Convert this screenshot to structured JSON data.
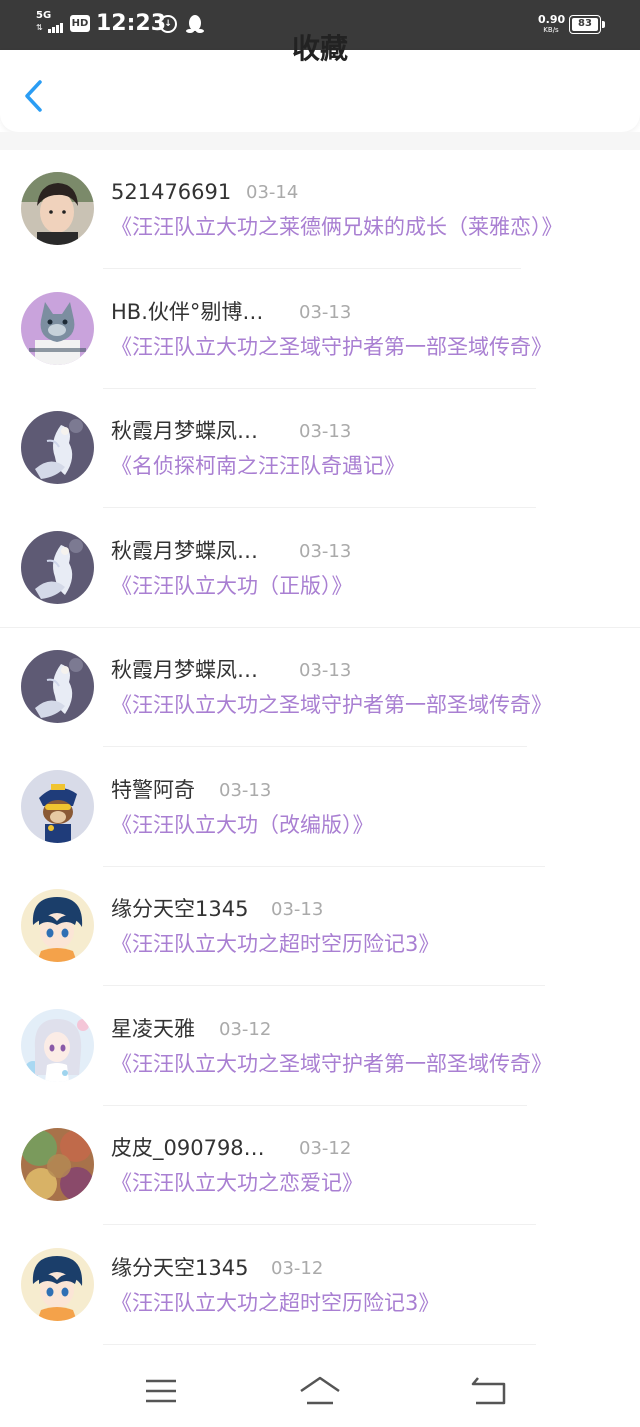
{
  "status_bar": {
    "network": "5G",
    "hd": "HD",
    "time": "12:23",
    "speed_value": "0.90",
    "speed_unit": "KB/s",
    "battery": "83"
  },
  "header": {
    "title": "收藏"
  },
  "items": [
    {
      "name": "521476691",
      "date": "03-14",
      "story": "《汪汪队立大功之莱德俩兄妹的成长（莱雅恋）》",
      "avatar": "boy-photo"
    },
    {
      "name": "HB.伙伴°剔博…",
      "date": "03-13",
      "story": "《汪汪队立大功之圣域守护者第一部圣域传奇》",
      "avatar": "wolf-cartoon"
    },
    {
      "name": "秋霞月梦蝶凤…",
      "date": "03-13",
      "story": "《名侦探柯南之汪汪队奇遇记》",
      "avatar": "white-anime-girl"
    },
    {
      "name": "秋霞月梦蝶凤…",
      "date": "03-13",
      "story": "《汪汪队立大功（正版）》",
      "avatar": "white-anime-girl"
    },
    {
      "name": "秋霞月梦蝶凤…",
      "date": "03-13",
      "story": "《汪汪队立大功之圣域守护者第一部圣域传奇》",
      "avatar": "white-anime-girl"
    },
    {
      "name": "特警阿奇",
      "date": "03-13",
      "story": "《汪汪队立大功（改编版）》",
      "avatar": "police-dog"
    },
    {
      "name": "缘分天空1345",
      "date": "03-13",
      "story": "《汪汪队立大功之超时空历险记3》",
      "avatar": "anime-boy"
    },
    {
      "name": "星凌天雅",
      "date": "03-12",
      "story": "《汪汪队立大功之圣域守护者第一部圣域传奇》",
      "avatar": "anime-girl-silver"
    },
    {
      "name": "皮皮_090798…",
      "date": "03-12",
      "story": "《汪汪队立大功之恋爱记》",
      "avatar": "colorful-blur"
    },
    {
      "name": "缘分天空1345",
      "date": "03-12",
      "story": "《汪汪队立大功之超时空历险记3》",
      "avatar": "anime-boy"
    }
  ],
  "colors": {
    "story_purple": "#a97fd2",
    "back_blue": "#2a9df4",
    "status_bg": "#3a3a3a"
  }
}
